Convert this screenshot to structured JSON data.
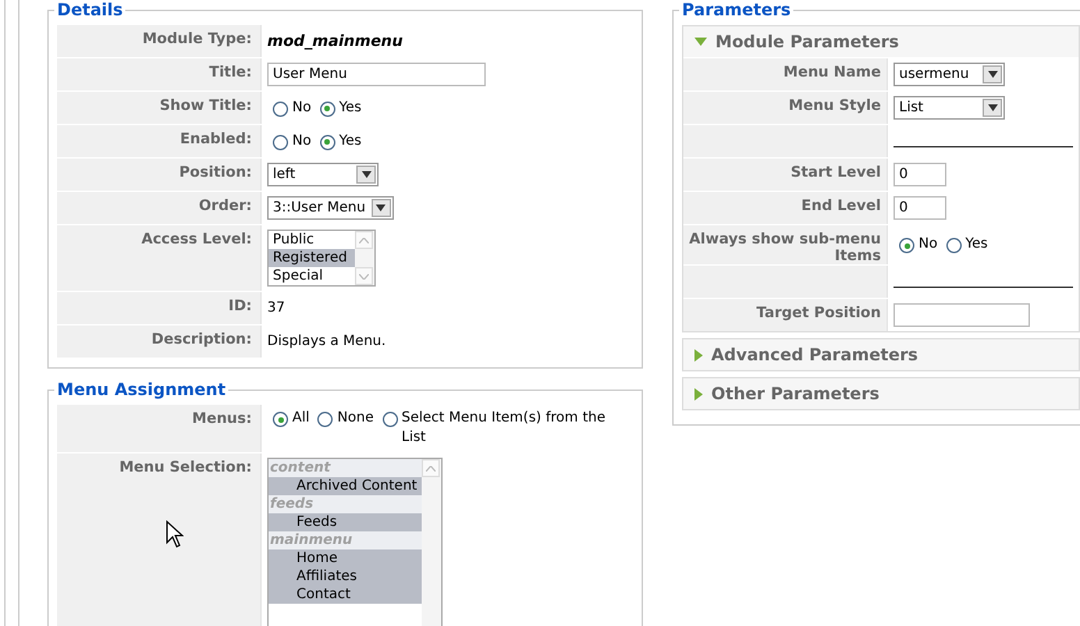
{
  "details": {
    "legend": "Details",
    "rows": [
      {
        "label": "Module Type:",
        "kind": "strong",
        "value": "mod_mainmenu"
      },
      {
        "label": "Title:",
        "kind": "input",
        "value": "User Menu"
      },
      {
        "label": "Show Title:",
        "kind": "radio",
        "options": [
          {
            "label": "No",
            "selected": false
          },
          {
            "label": "Yes",
            "selected": true
          }
        ]
      },
      {
        "label": "Enabled:",
        "kind": "radio",
        "options": [
          {
            "label": "No",
            "selected": false
          },
          {
            "label": "Yes",
            "selected": true
          }
        ]
      },
      {
        "label": "Position:",
        "kind": "select",
        "value": "left"
      },
      {
        "label": "Order:",
        "kind": "select",
        "value": "3::User Menu"
      },
      {
        "label": "Access Level:",
        "kind": "listbox",
        "options": [
          {
            "label": "Public",
            "selected": false
          },
          {
            "label": "Registered",
            "selected": true
          },
          {
            "label": "Special",
            "selected": false
          }
        ]
      },
      {
        "label": "ID:",
        "kind": "text",
        "value": "37"
      },
      {
        "label": "Description:",
        "kind": "text",
        "value": "Displays a Menu."
      }
    ]
  },
  "menu_assignment": {
    "legend": "Menu Assignment",
    "rows": [
      {
        "label": "Menus:",
        "kind": "radio",
        "options": [
          {
            "label": "All",
            "selected": true
          },
          {
            "label": "None",
            "selected": false
          },
          {
            "label": "Select Menu Item(s) from the List",
            "selected": false
          }
        ]
      },
      {
        "label": "Menu Selection:",
        "kind": "grouplist",
        "items": [
          {
            "kind": "group",
            "label": "content"
          },
          {
            "kind": "item",
            "label": "Archived Content",
            "selected": true
          },
          {
            "kind": "group",
            "label": "feeds"
          },
          {
            "kind": "item",
            "label": "Feeds",
            "selected": true
          },
          {
            "kind": "group",
            "label": "mainmenu"
          },
          {
            "kind": "item",
            "label": "Home",
            "selected": true
          },
          {
            "kind": "item",
            "label": "Affiliates",
            "selected": true
          },
          {
            "kind": "item",
            "label": "Contact",
            "selected": true
          }
        ]
      }
    ]
  },
  "parameters": {
    "legend": "Parameters",
    "panels": [
      {
        "title": "Module Parameters",
        "expanded": true,
        "rows": [
          {
            "label": "Menu Name",
            "kind": "select",
            "value": "usermenu"
          },
          {
            "label": "Menu Style",
            "kind": "select",
            "value": "List"
          },
          {
            "kind": "spacer"
          },
          {
            "label": "Start Level",
            "kind": "input",
            "value": "0"
          },
          {
            "label": "End Level",
            "kind": "input",
            "value": "0"
          },
          {
            "label": "Always show sub-menu Items",
            "kind": "radio",
            "options": [
              {
                "label": "No",
                "selected": true
              },
              {
                "label": "Yes",
                "selected": false
              }
            ]
          },
          {
            "kind": "spacer"
          },
          {
            "label": "Target Position",
            "kind": "input",
            "value": ""
          }
        ]
      },
      {
        "title": "Advanced Parameters",
        "expanded": false
      },
      {
        "title": "Other Parameters",
        "expanded": false
      }
    ]
  }
}
